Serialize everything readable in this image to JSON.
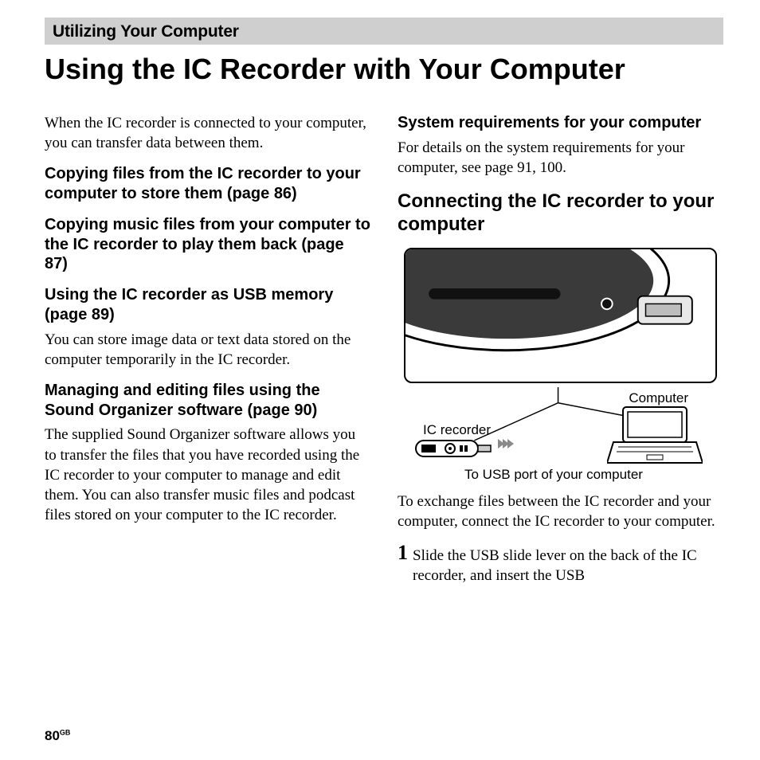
{
  "banner": "Utilizing Your Computer",
  "title": "Using the IC Recorder with Your Computer",
  "left": {
    "intro": "When the IC recorder is connected to your computer, you can transfer data between them.",
    "h1": "Copying files from the IC recorder to your computer to store them (page 86)",
    "h2": "Copying music files from your computer to the IC recorder to play them back (page 87)",
    "h3": "Using the IC recorder as USB memory (page 89)",
    "p3": "You can store image data or text data stored on the computer temporarily in the IC recorder.",
    "h4": "Managing and editing files using the Sound Organizer software (page 90)",
    "p4": "The supplied Sound Organizer software allows you to transfer the files that you have recorded using the IC recorder to your computer to manage and edit them. You can also transfer music files and podcast files stored on your computer to the IC recorder."
  },
  "right": {
    "h1": "System requirements for your computer",
    "p1": "For details on the system requirements for your computer, see page 91, 100.",
    "h2": "Connecting the IC recorder to your computer",
    "label_ic": "IC recorder",
    "label_computer": "Computer",
    "label_usb": "To USB port of your computer",
    "p2": "To exchange files between the IC recorder and your computer, connect the IC recorder to your computer.",
    "step_num": "1",
    "step_text": "Slide the USB slide lever on the back of the IC recorder, and insert the USB"
  },
  "footer": {
    "page": "80",
    "region": "GB"
  }
}
